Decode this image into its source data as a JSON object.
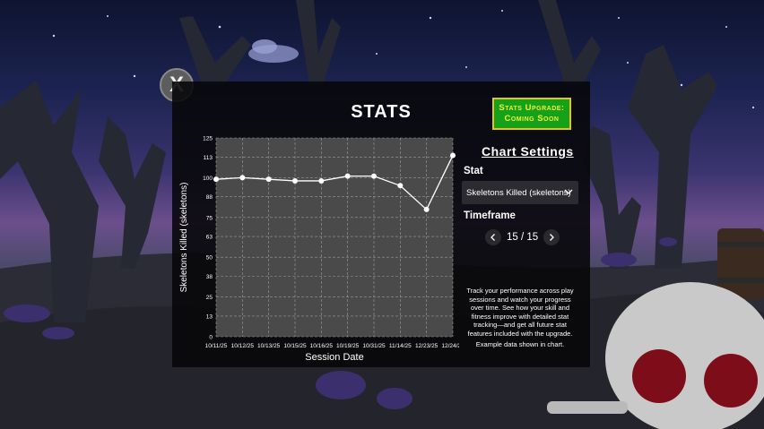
{
  "close_button": {
    "label": "X"
  },
  "panel": {
    "title": "STATS",
    "upgrade_badge": "Stats Upgrade:\nComing Soon"
  },
  "settings": {
    "title": "Chart Settings",
    "stat_label": "Stat",
    "stat_value": "Skeletons Killed (skeletons)",
    "timeframe_label": "Timeframe",
    "page_text": "15 / 15",
    "description": "Track your performance across play sessions and watch your progress over time. See how your skill and fitness improve with detailed stat tracking—and get all future stat features included with the upgrade.",
    "note": "Example data shown in chart."
  },
  "colors": {
    "panel_bg": "#08080a",
    "plot_bg": "#4a4a4a",
    "badge_bg": "#14a21a",
    "badge_border": "#e8c21b",
    "badge_text": "#f5ec39"
  },
  "icons": [
    "close-icon",
    "chevron-down-icon",
    "chevron-left-icon",
    "chevron-right-icon"
  ],
  "chart_data": {
    "type": "line",
    "xlabel": "Session Date",
    "ylabel": "Skeletons Killed (skeletons)",
    "ylim": [
      0,
      125
    ],
    "yticks": [
      0,
      13,
      25,
      38,
      50,
      63,
      75,
      88,
      100,
      113,
      125
    ],
    "grid": true,
    "categories": [
      "10/11/25",
      "10/12/25",
      "10/13/25",
      "10/15/25",
      "10/16/25",
      "10/19/25",
      "10/31/25",
      "11/14/25",
      "12/23/25",
      "12/24/25"
    ],
    "series": [
      {
        "values": [
          99,
          100,
          99,
          98,
          98,
          101,
          101,
          95,
          80,
          114
        ]
      }
    ]
  }
}
